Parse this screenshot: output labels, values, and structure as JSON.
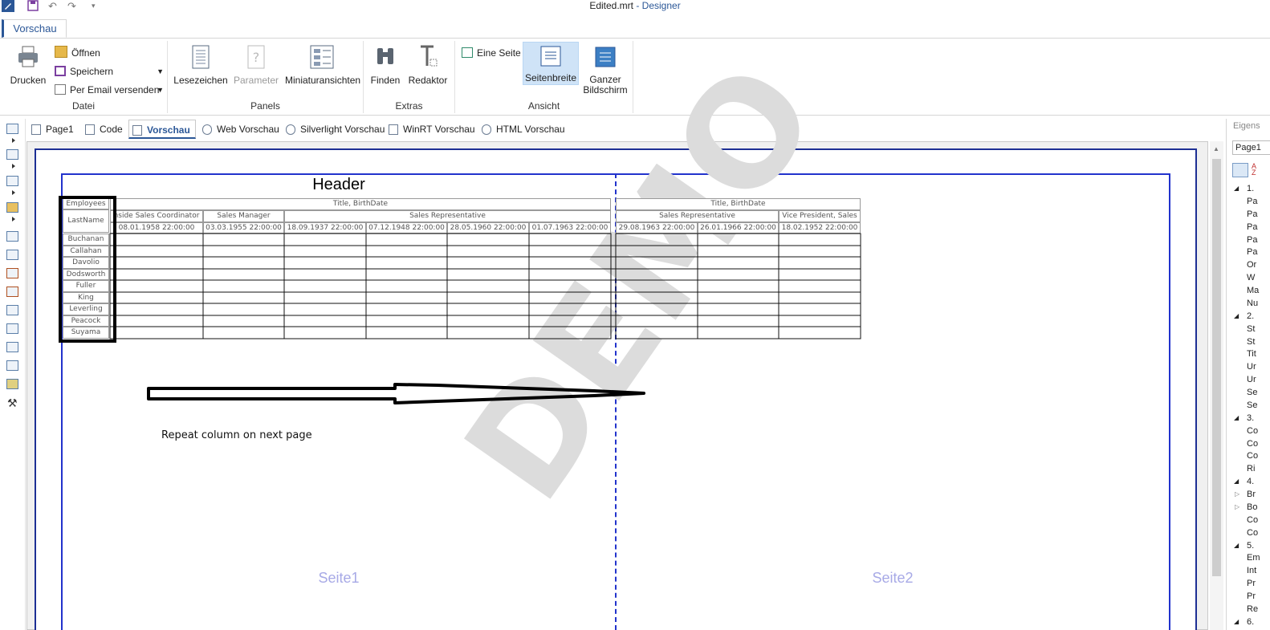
{
  "titlebar": {
    "file": "Edited.mrt",
    "app": " - Designer"
  },
  "ribbon_tab": "Vorschau",
  "ribbon": {
    "datei": {
      "label": "Datei",
      "print": "Drucken",
      "open": "Öffnen",
      "save": "Speichern",
      "email": "Per Email versenden"
    },
    "panels": {
      "label": "Panels",
      "bookmarks": "Lesezeichen",
      "parameters": "Parameter",
      "thumbnails": "Miniaturansichten"
    },
    "extras": {
      "label": "Extras",
      "find": "Finden",
      "editor": "Redaktor"
    },
    "ansicht": {
      "label": "Ansicht",
      "one_page": "Eine Seite",
      "page_width": "Seitenbreite",
      "fullscreen_1": "Ganzer",
      "fullscreen_2": "Bildschirm"
    }
  },
  "doc_tabs": [
    "Page1",
    "Code",
    "Vorschau",
    "Web Vorschau",
    "Silverlight Vorschau",
    "WinRT Vorschau",
    "HTML Vorschau"
  ],
  "report": {
    "header": "Header",
    "corner_title": "Employees",
    "corner_sub": "LastName",
    "group_title_1": "Title, BirthDate",
    "group_title_2": "Title, BirthDate",
    "titles_p1": [
      "nside Sales Coordinator",
      "Sales Manager",
      "Sales Representative"
    ],
    "titles_p2": [
      "Sales Representative",
      "Vice President, Sales"
    ],
    "dates_p1": [
      "08.01.1958 22:00:00",
      "03.03.1955 22:00:00",
      "18.09.1937 22:00:00",
      "07.12.1948 22:00:00",
      "28.05.1960 22:00:00",
      "01.07.1963 22:00:00"
    ],
    "dates_p2": [
      "29.08.1963 22:00:00",
      "26.01.1966 22:00:00",
      "18.02.1952 22:00:00"
    ],
    "rows": [
      "Buchanan",
      "Callahan",
      "Davolio",
      "Dodsworth",
      "Fuller",
      "King",
      "Leverling",
      "Peacock",
      "Suyama"
    ],
    "annotation": "Repeat column on next page",
    "page1_label": "Seite1",
    "page2_label": "Seite2",
    "watermark": "DEMO"
  },
  "right_panel": {
    "title": "Eigens",
    "selector": "Page1",
    "categories": [
      "1.",
      "2.",
      "3.",
      "4.",
      "5.",
      "6."
    ],
    "items": [
      "Pa",
      "Pa",
      "Pa",
      "Pa",
      "Pa",
      "Or",
      "W",
      "Ma",
      "Nu",
      "St",
      "St",
      "Tit",
      "Ur",
      "Ur",
      "Se",
      "Se",
      "Co",
      "Co",
      "Co",
      "Ri",
      "Br",
      "Bo",
      "Co",
      "Co",
      "Em",
      "Int",
      "Pr",
      "Pr",
      "Re"
    ]
  },
  "colors": {
    "accent": "#2b5797",
    "page_border": "#1d2f94",
    "page_label": "#a7a9e6",
    "watermark": "#dcdcdc"
  }
}
